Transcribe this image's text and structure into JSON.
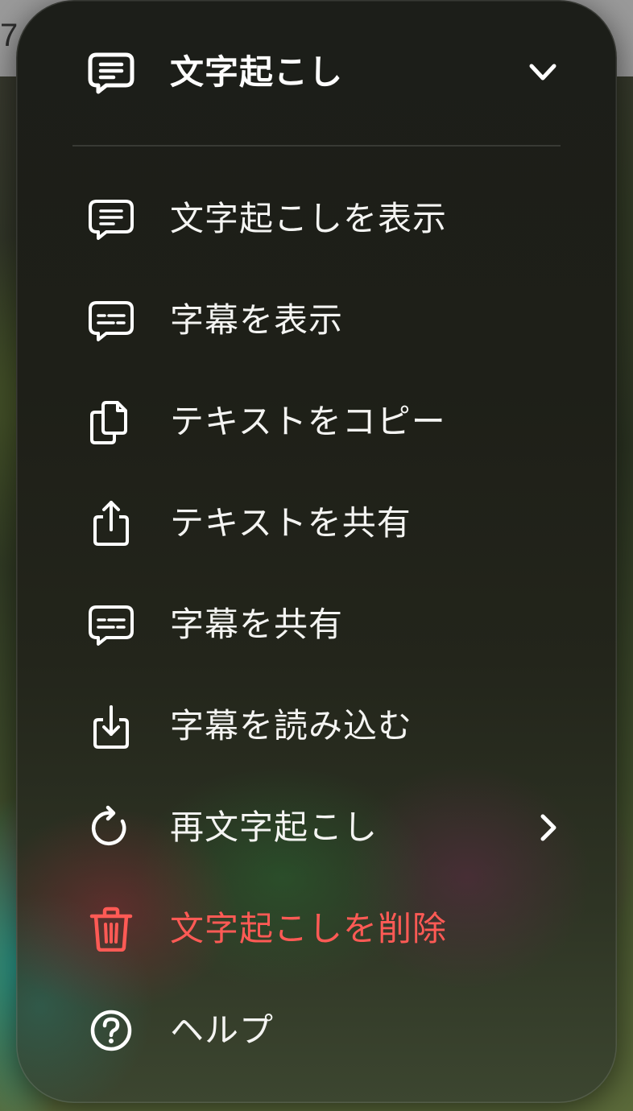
{
  "status": {
    "corner_digit": "7"
  },
  "menu": {
    "header": {
      "title": "文字起こし",
      "icon": "transcript-bubble-icon",
      "toggle_icon": "chevron-down-icon"
    },
    "items": [
      {
        "label": "文字起こしを表示",
        "icon": "transcript-bubble-icon"
      },
      {
        "label": "字幕を表示",
        "icon": "subtitles-bubble-icon"
      },
      {
        "label": "テキストをコピー",
        "icon": "copy-documents-icon"
      },
      {
        "label": "テキストを共有",
        "icon": "share-icon"
      },
      {
        "label": "字幕を共有",
        "icon": "subtitles-bubble-icon"
      },
      {
        "label": "字幕を読み込む",
        "icon": "import-tray-icon"
      },
      {
        "label": "再文字起こし",
        "icon": "redo-circular-arrow-icon",
        "submenu_icon": "chevron-right-icon"
      },
      {
        "label": "文字起こしを削除",
        "icon": "trash-icon",
        "destructive": true
      },
      {
        "label": "ヘルプ",
        "icon": "question-circle-icon"
      }
    ],
    "colors": {
      "text": "#f4f4f2",
      "destructive": "#ff5a55",
      "panel": "#1e1f18"
    }
  }
}
